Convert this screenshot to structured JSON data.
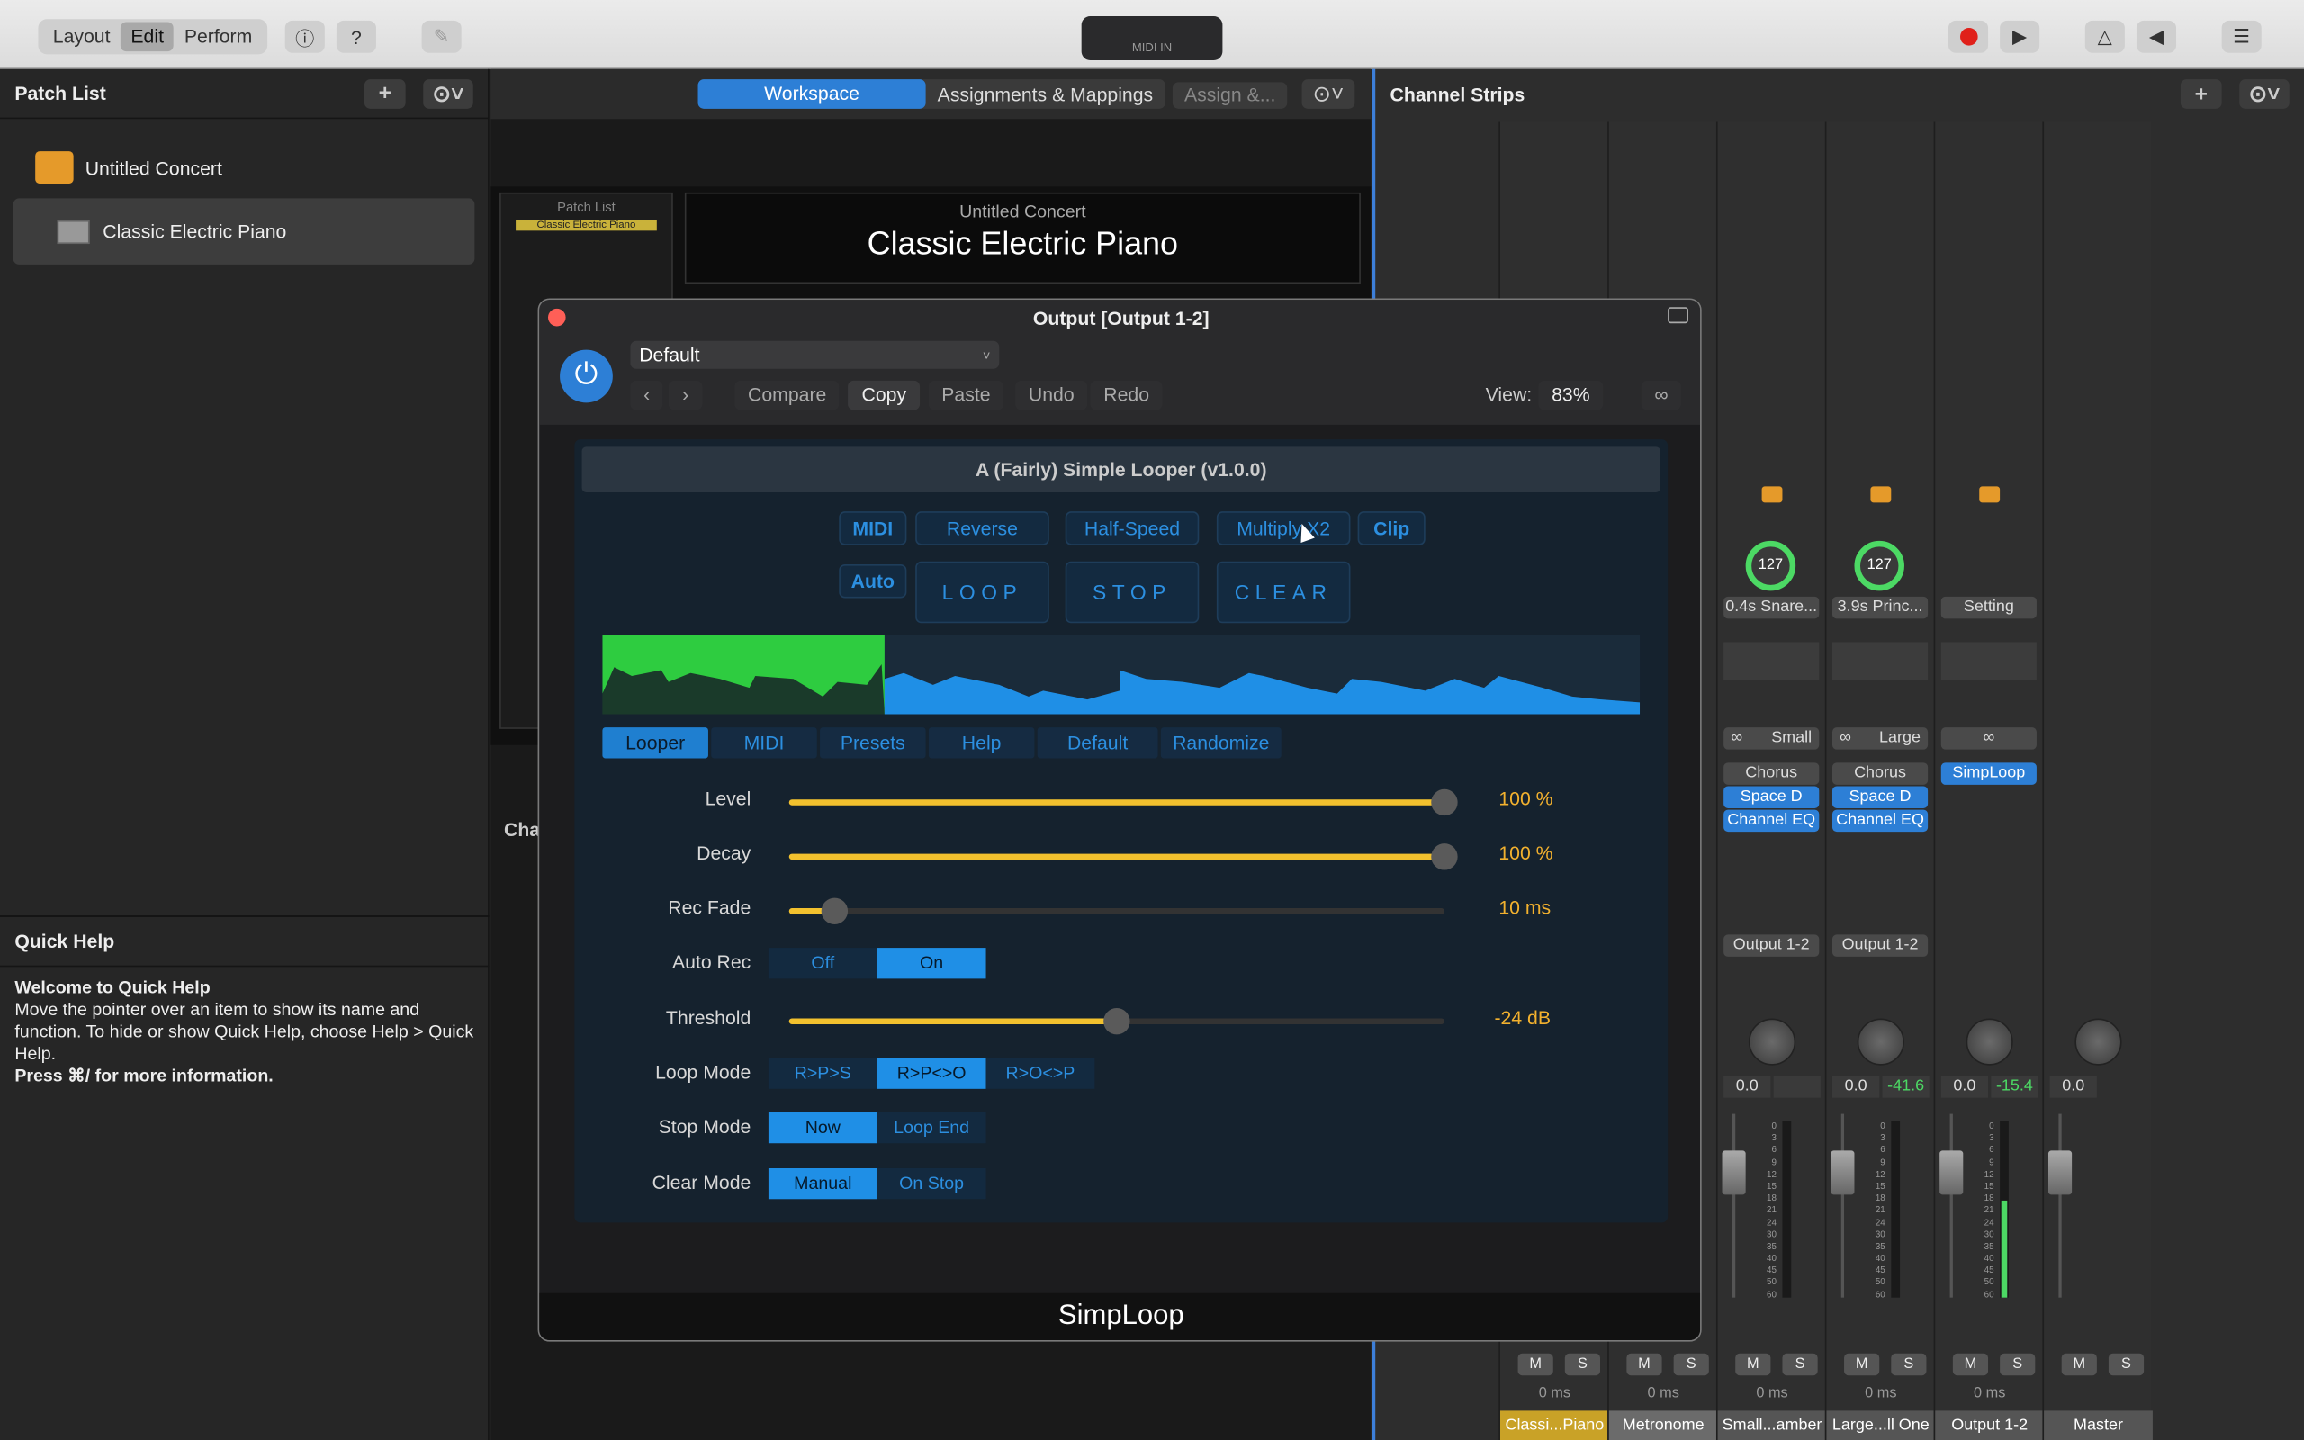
{
  "toolbar": {
    "modes": [
      "Layout",
      "Edit",
      "Perform"
    ],
    "active_mode": "Edit",
    "midi_in": "MIDI IN"
  },
  "patch_list": {
    "title": "Patch List",
    "items": [
      {
        "label": "Untitled Concert"
      },
      {
        "label": "Classic Electric Piano"
      }
    ]
  },
  "quick_help": {
    "title": "Quick Help",
    "heading": "Welcome to Quick Help",
    "body": "Move the pointer over an item to show its name and function. To hide or show Quick Help, choose Help > Quick Help.",
    "footer": "Press ⌘/ for more information."
  },
  "workspace": {
    "tabs": [
      "Workspace",
      "Assignments & Mappings",
      "Assign &..."
    ],
    "mini_label": "Patch List",
    "mini_patch": "Classic Electric Piano",
    "concert": "Untitled Concert",
    "patch": "Classic Electric Piano",
    "partial": "Cha"
  },
  "channel_strips": {
    "title": "Channel Strips",
    "strips": [
      {
        "name": "Classi...Piano",
        "latency": "0 ms"
      },
      {
        "name": "Metronome",
        "latency": "0 ms"
      },
      {
        "name": "Small...amber",
        "latency": "0 ms",
        "knob": "127",
        "send": "0.4s Snare...",
        "mono": "Small",
        "inserts": [
          "Chorus",
          "Space D",
          "Channel EQ"
        ],
        "output": "Output 1-2",
        "pan": "0.0",
        "peak": ""
      },
      {
        "name": "Large...ll One",
        "latency": "0 ms",
        "knob": "127",
        "send": "3.9s Princ...",
        "mono": "Large",
        "inserts": [
          "Chorus",
          "Space D",
          "Channel EQ"
        ],
        "output": "Output 1-2",
        "pan": "0.0",
        "peak": "-41.6"
      },
      {
        "name": "Output 1-2",
        "latency": "0 ms",
        "send": "Setting",
        "inserts": [
          "SimpLoop"
        ],
        "pan": "0.0",
        "peak": "-15.4"
      },
      {
        "name": "Master",
        "pan": "0.0"
      }
    ],
    "meter_scale": [
      "0",
      "3",
      "6",
      "9",
      "12",
      "15",
      "18",
      "21",
      "24",
      "30",
      "35",
      "40",
      "45",
      "50",
      "60"
    ],
    "mute": "M",
    "solo": "S"
  },
  "plugin": {
    "title": "Output [Output 1-2]",
    "preset": "Default",
    "buttons": [
      "Compare",
      "Copy",
      "Paste",
      "Undo",
      "Redo"
    ],
    "view_label": "View:",
    "view_value": "83%",
    "footer": "SimpLoop",
    "header": "A (Fairly) Simple Looper (v1.0.0)",
    "row1": [
      "MIDI",
      "Reverse",
      "Half-Speed",
      "Multiply X2",
      "Clip"
    ],
    "auto": "Auto",
    "row2": [
      "LOOP",
      "STOP",
      "CLEAR"
    ],
    "tabs": [
      "Looper",
      "MIDI",
      "Presets",
      "Help",
      "Default",
      "Randomize"
    ],
    "params": {
      "level": {
        "label": "Level",
        "value": "100 %",
        "pct": 1.0
      },
      "decay": {
        "label": "Decay",
        "value": "100 %",
        "pct": 1.0
      },
      "rec_fade": {
        "label": "Rec Fade",
        "value": "10 ms",
        "pct": 0.07
      },
      "threshold": {
        "label": "Threshold",
        "value": "-24 dB",
        "pct": 0.5
      },
      "auto_rec": {
        "label": "Auto Rec",
        "options": [
          "Off",
          "On"
        ],
        "selected": "On"
      },
      "loop_mode": {
        "label": "Loop Mode",
        "options": [
          "R>P>S",
          "R>P<>O",
          "R>O<>P"
        ],
        "selected": "R>P<>O"
      },
      "stop_mode": {
        "label": "Stop Mode",
        "options": [
          "Now",
          "Loop End"
        ],
        "selected": "Now"
      },
      "clear_mode": {
        "label": "Clear Mode",
        "options": [
          "Manual",
          "On Stop"
        ],
        "selected": "Manual"
      }
    }
  },
  "colors": {
    "accent": "#1f7fd0",
    "waveform_active": "#2ecc40",
    "waveform": "#1f8fe6",
    "slider": "#f2c12e",
    "record": "#e0201a"
  }
}
